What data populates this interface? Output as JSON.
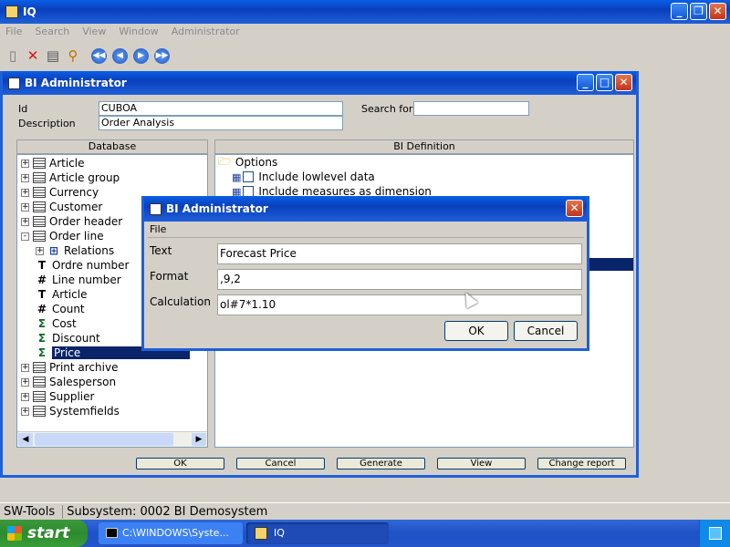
{
  "app": {
    "title": "IQ"
  },
  "menu": [
    "File",
    "Search",
    "View",
    "Window",
    "Administrator"
  ],
  "bi_window": {
    "title": "BI Administrator",
    "id_label": "Id",
    "id_value": "CUBOA",
    "desc_label": "Description",
    "desc_value": "Order Analysis",
    "search_label": "Search for",
    "search_value": ""
  },
  "database": {
    "header": "Database",
    "items": [
      {
        "label": "Article",
        "icon": "table-icon",
        "expand": "+"
      },
      {
        "label": "Article group",
        "icon": "table-icon",
        "expand": "+"
      },
      {
        "label": "Currency",
        "icon": "table-icon",
        "expand": "+"
      },
      {
        "label": "Customer",
        "icon": "table-icon",
        "expand": "+"
      },
      {
        "label": "Order header",
        "icon": "table-icon",
        "expand": "+"
      },
      {
        "label": "Order line",
        "icon": "table-icon",
        "expand": "-"
      },
      {
        "label": "Relations",
        "icon": "relation-icon",
        "expand": "+"
      },
      {
        "label": "Ordre number",
        "icon": "text-field-icon"
      },
      {
        "label": "Line number",
        "icon": "number-field-icon"
      },
      {
        "label": "Article",
        "icon": "text-field-icon"
      },
      {
        "label": "Count",
        "icon": "number-field-icon"
      },
      {
        "label": "Cost",
        "icon": "sum-field-icon"
      },
      {
        "label": "Discount",
        "icon": "sum-field-icon"
      },
      {
        "label": "Price",
        "icon": "sum-field-icon",
        "selected": true
      },
      {
        "label": "Print archive",
        "icon": "table-icon",
        "expand": "+"
      },
      {
        "label": "Salesperson",
        "icon": "table-icon",
        "expand": "+"
      },
      {
        "label": "Supplier",
        "icon": "table-icon",
        "expand": "+"
      },
      {
        "label": "Systemfields",
        "icon": "table-icon",
        "expand": "+"
      }
    ]
  },
  "bi_definition": {
    "header": "BI Definition",
    "options_label": "Options",
    "opt1": "Include lowlevel data",
    "opt2": "Include measures as dimension"
  },
  "buttons": {
    "ok": "OK",
    "cancel": "Cancel",
    "generate": "Generate",
    "view": "View",
    "change": "Change report"
  },
  "dialog": {
    "title": "BI Administrator",
    "menu_file": "File",
    "text_label": "Text",
    "text_value": "Forecast Price",
    "format_label": "Format",
    "format_value": ",9,2",
    "calc_label": "Calculation",
    "calc_value": "ol#7*1.10",
    "ok": "OK",
    "cancel": "Cancel"
  },
  "status": {
    "left": "SW-Tools",
    "right": "Subsystem: 0002 BI Demosystem"
  },
  "taskbar": {
    "start": "start",
    "task1": "C:\\WINDOWS\\Syste...",
    "task2": "IQ"
  }
}
